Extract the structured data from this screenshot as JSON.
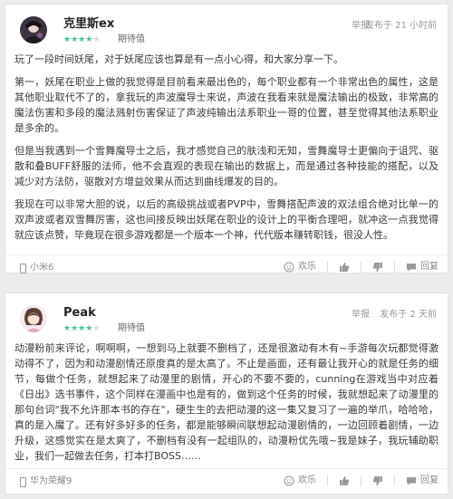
{
  "colors": {
    "star_active": "#3ec1a5",
    "star_inactive": "#d9d9d9",
    "background": "#ececec"
  },
  "reviews": [
    {
      "username": "克里斯ex",
      "rating": 4,
      "rating_label": "期待值",
      "report_label": "举报",
      "posted": "发布于 21 小时前",
      "paragraphs": [
        "玩了一段时间妖尾，对于妖尾应该也算是有一点小心得，和大家分享一下。",
        "第一，妖尾在职业上做的我觉得是目前看来最出色的，每个职业都有一个非常出色的属性，这是其他职业取代不了的，拿我玩的声波魔导士来说，声波在我看来就是魔法输出的极致，非常高的魔法伤害和多段的魔法溅射伤害保证了声波纯输出法系职业一哥的位置，甚至觉得其他法系职业是多余的。",
        "但是当我遇到一个雪舞魔导士之后，我才感觉自己的肤浅和无知，雪舞魔导士更偏向于诅咒、驱散和叠BUFF舒服的法师，他不会直观的表现在输出的数据上，而是通过各种技能的搭配，以及减少对方法防，驱散对方增益效果从而达到曲线爆发的目的。",
        "我现在可以非常大胆的说，以后的高级挑战或者PVP中，雪舞搭配声波的双法组合绝对比单一的双声波或者双雪舞厉害，这也间接反映出妖尾在职业的设计上的平衡合理吧，就冲这一点我觉得就应该点赞，毕竟现在很多游戏都是一个版本一个神，代代版本赚转职钱，很没人性。"
      ],
      "device": "小米6",
      "like_label": "欢乐",
      "comment_label": "回复"
    },
    {
      "username": "Peak",
      "rating": 4,
      "rating_label": "期待值",
      "report_label": "举报",
      "posted": "发布于 2 天前",
      "paragraphs": [
        "动漫粉前来评论，啊啊啊，一想到马上就要不删档了，还是很激动有木有~手游每次玩都觉得激动得不了，因为和动漫剧情还原度真的是太高了。不止是画面，还有最让我开心的就是任务的细节，每做个任务，就想起来了动漫里的剧情，开心的不要不要的，cunning在游戏当中对应着《日出》选书事件，这个同样在漫画中也是有的，做到这个任务的时候，我就想起来了动漫里的那句台词\"我不允许那本书的存在\"，硬生生的去把动漫的这一集又复习了一遍的举爪，哈哈哈，真的是入魔了。还有好多好多的任务，都是能够瞬间联想起动漫剧情的，一边回顾着剧情，一边升级，这感觉实在是太爽了，不删档有没有一起组队的，动漫粉优先哦~我是妹子，我玩辅助职业，我们一起做去任务，打本打BOSS……"
      ],
      "device": "华为荣耀9",
      "like_label": "欢乐",
      "comment_label": "回复"
    }
  ]
}
